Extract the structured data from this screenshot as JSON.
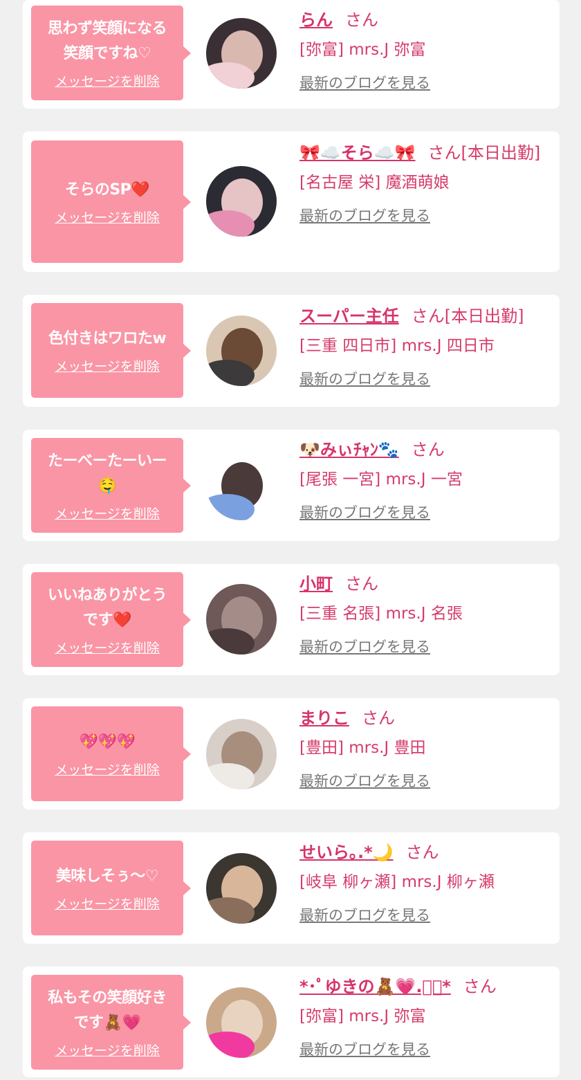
{
  "delete_label": "メッセージを削除",
  "blog_label": "最新のブログを見る",
  "honorific": "さん",
  "cards": [
    {
      "message_lines": [
        "思わず笑顔になる",
        "笑顔ですね♡"
      ],
      "name": "らん",
      "suffix": "",
      "shop": "[弥富] mrs.J 弥富"
    },
    {
      "message_lines": [
        "そらのSP❤️"
      ],
      "name": "🎀☁️そら☁️🎀",
      "suffix": "[本日出勤]",
      "shop": "[名古屋 栄] 魔酒萌娘"
    },
    {
      "message_lines": [
        "色付きはワロたw"
      ],
      "name": "スーパー主任",
      "suffix": "[本日出勤]",
      "shop": "[三重 四日市] mrs.J 四日市"
    },
    {
      "message_lines": [
        "たーべーたーいー",
        "🤤"
      ],
      "name": "🐶みぃﾁｬﾝ🐾",
      "suffix": "",
      "shop": "[尾張 一宮] mrs.J 一宮"
    },
    {
      "message_lines": [
        "いいねありがとう",
        "です❤️"
      ],
      "name": "小町",
      "suffix": "",
      "shop": "[三重 名張] mrs.J 名張"
    },
    {
      "message_lines": [
        "💖💖💖"
      ],
      "name": "まりこ",
      "suffix": "",
      "shop": "[豊田] mrs.J 豊田"
    },
    {
      "message_lines": [
        "美味しそぅ〜♡"
      ],
      "name": "せいら｡.*🌙",
      "suffix": "",
      "shop": "[岐阜 柳ヶ瀬] mrs.J 柳ヶ瀬"
    },
    {
      "message_lines": [
        "私もその笑顔好き",
        "です🧸💗"
      ],
      "name": "*･ﾟゆきの🧸💗.ﾟ･*",
      "suffix": "",
      "shop": "[弥富] mrs.J 弥富"
    }
  ]
}
